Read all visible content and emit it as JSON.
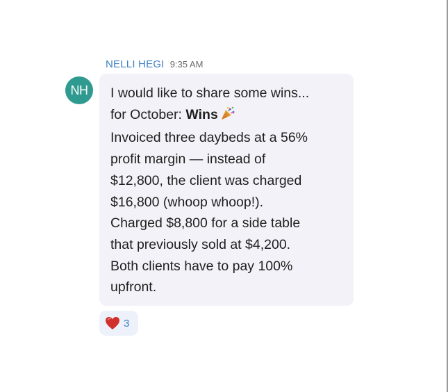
{
  "message": {
    "sender_name": "NELLI HEGI",
    "timestamp": "9:35 AM",
    "avatar_initials": "NH",
    "avatar_color": "#2f9a8f",
    "lines": {
      "l1": "I would like to share some wins...",
      "l2_prefix": "for October: ",
      "l2_bold": "Wins",
      "l3": "Invoiced three daybeds at a 56%",
      "l4": "profit margin — instead of",
      "l5": "$12,800, the client was charged",
      "l6": "$16,800 (whoop whoop!).",
      "l7": "Charged $8,800 for a side table",
      "l8": "that previously sold at $4,200.",
      "l9": "Both clients have to pay 100%",
      "l10": "upfront."
    },
    "inline_icon": "party-popper-icon"
  },
  "reaction": {
    "icon": "heart-icon",
    "count": "3"
  },
  "colors": {
    "name_blue": "#3f7fc4",
    "bubble_bg": "#f3f2f8",
    "reaction_bg": "#ecf1fa",
    "heart_red": "#d0312d"
  }
}
